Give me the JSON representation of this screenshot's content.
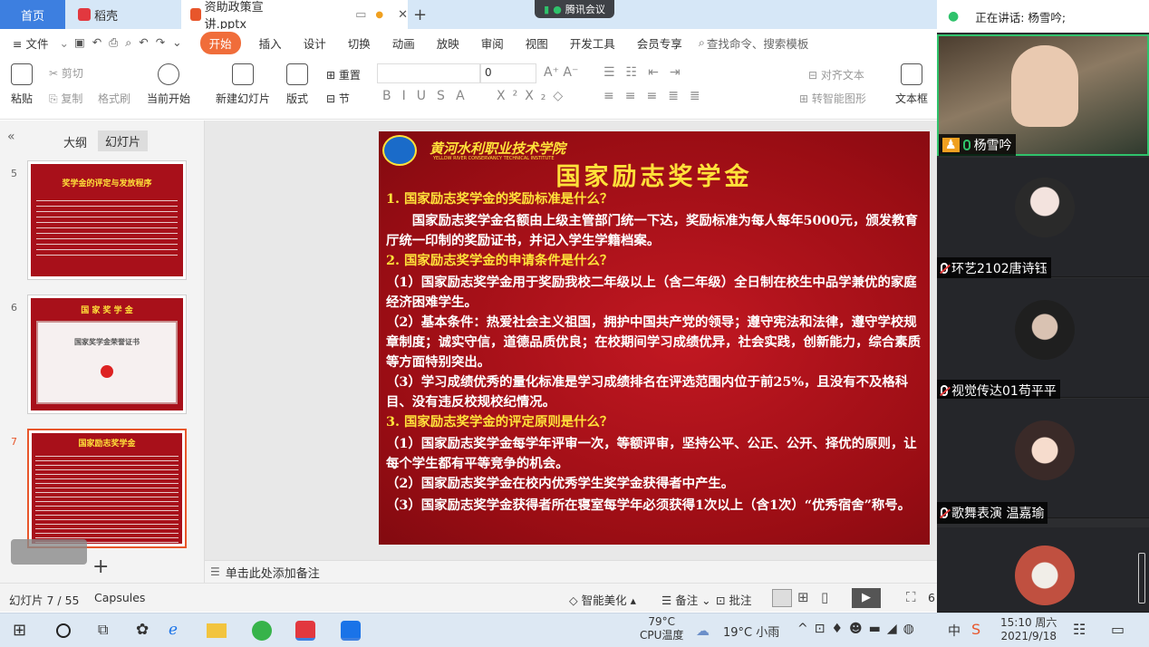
{
  "titlebar": {
    "tabs": [
      {
        "label": "首页"
      },
      {
        "label": "稻壳"
      },
      {
        "label": "资助政策宣讲.pptx"
      }
    ],
    "new_tab": "+",
    "meeting_pill": "腾讯会议"
  },
  "menubar": {
    "file": "≡ 文件",
    "items": [
      "开始",
      "插入",
      "设计",
      "切换",
      "动画",
      "放映",
      "审阅",
      "视图",
      "开发工具",
      "会员专享"
    ],
    "search": "查找命令、搜索模板"
  },
  "ribbon": {
    "paste": "粘贴",
    "cut": "剪切",
    "copy": "复制",
    "format_painter": "格式刷",
    "from_current": "当前开始",
    "new_slide": "新建幻灯片",
    "layout": "版式",
    "reset": "重置",
    "section": "节",
    "font_size": "0",
    "align_text": "对齐文本",
    "smart_graphic": "转智能图形",
    "textbox": "文本框"
  },
  "leftpanel": {
    "tab_outline": "大纲",
    "tab_slides": "幻灯片",
    "thumbs": [
      {
        "num": "5",
        "title": "奖学金的评定与发放程序"
      },
      {
        "num": "6",
        "title": "国 家 奖 学 金",
        "cert": "国家奖学金荣誉证书"
      },
      {
        "num": "7",
        "title": "国家励志奖学金"
      }
    ],
    "add": "+"
  },
  "slide": {
    "school": "黄河水利职业技术学院",
    "school_en": "YELLOW RIVER CONSERVANCY TECHNICAL INSTITUTE",
    "title": "国家励志奖学金",
    "q1": "1. 国家励志奖学金的奖励标准是什么？",
    "a1": "　　国家励志奖学金名额由上级主管部门统一下达，奖励标准为每人每年5000元，颁发教育厅统一印制的奖励证书，并记入学生学籍档案。",
    "q2": "2. 国家励志奖学金的申请条件是什么？",
    "a2_1": "（1）国家励志奖学金用于奖励我校二年级以上（含二年级）全日制在校生中品学兼优的家庭经济困难学生。",
    "a2_2": "（2）基本条件：热爱社会主义祖国，拥护中国共产党的领导；遵守宪法和法律，遵守学校规章制度；诚实守信，道德品质优良；在校期间学习成绩优异，社会实践，创新能力，综合素质等方面特别突出。",
    "a2_3": "（3）学习成绩优秀的量化标准是学习成绩排名在评选范围内位于前25%，且没有不及格科目、没有违反校规校纪情况。",
    "q3": "3. 国家励志奖学金的评定原则是什么？",
    "a3_1": "（1）国家励志奖学金每学年评审一次，等额评审，坚持公平、公正、公开、择优的原则，让每个学生都有平等竞争的机会。",
    "a3_2": "（2）国家励志奖学金在校内优秀学生奖学金获得者中产生。",
    "a3_3": "（3）国家励志奖学金获得者所在寝室每学年必须获得1次以上（含1次）“优秀宿舍”称号。"
  },
  "notes": {
    "placeholder": "单击此处添加备注"
  },
  "statusbar": {
    "slide_info": "幻灯片 7 / 55",
    "theme": "Capsules",
    "beautify": "智能美化",
    "notes": "备注",
    "comment": "批注",
    "zoom": "6"
  },
  "meeting": {
    "speaking": "正在讲话: 杨雪吟;",
    "participants": [
      {
        "name": "杨雪吟",
        "muted": false
      },
      {
        "name": "环艺2102唐诗钰",
        "muted": true
      },
      {
        "name": "视觉传达01苟平平",
        "muted": true
      },
      {
        "name": "歌舞表演 温嘉瑜",
        "muted": true
      },
      {
        "name": "",
        "muted": true
      }
    ]
  },
  "taskbar": {
    "cpu_temp": "79°C",
    "cpu_label": "CPU温度",
    "weather": "19°C 小雨",
    "ime": "中",
    "time": "15:10 周六",
    "date": "2021/9/18"
  },
  "colors": {
    "slide_red": "#a8101a",
    "slide_yellow": "#ffe13a",
    "accent_orange": "#f06d3a",
    "tab_blue": "#3d7fe0"
  }
}
